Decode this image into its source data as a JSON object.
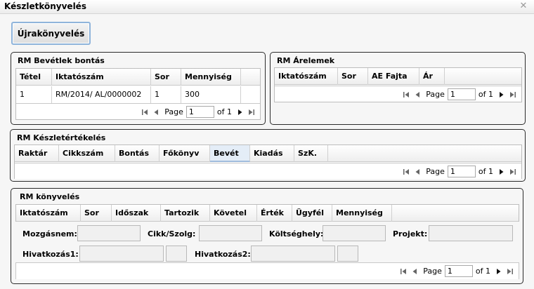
{
  "window": {
    "title": "Készletkönyvelés"
  },
  "toolbar": {
    "rebook_label": "Újrakönyvelés"
  },
  "pager_text": {
    "page": "Page",
    "of": "of 1",
    "page_value": "1"
  },
  "bevetel": {
    "title": "RM Bevétlek bontás",
    "columns": [
      "Tétel",
      "Iktatószám",
      "Sor",
      "Mennyiség"
    ],
    "rows": [
      [
        "1",
        "RM/2014/  AL/0000002",
        "1",
        "300"
      ]
    ]
  },
  "arelemek": {
    "title": "RM Árelemek",
    "columns": [
      "Iktatószám",
      "Sor",
      "AE Fajta",
      "Ár"
    ]
  },
  "keszletertekeles": {
    "title": "RM Készletértékelés",
    "columns": [
      "Raktár",
      "Cikkszám",
      "Bontás",
      "Főkönyv",
      "Bevét",
      "Kiadás",
      "SzK."
    ]
  },
  "konyveles": {
    "title": "RM könyvelés",
    "columns": [
      "Iktatószám",
      "Sor",
      "Időszak",
      "Tartozik",
      "Követel",
      "Érték",
      "Ügyfél",
      "Mennyiség"
    ],
    "fields": {
      "mozgasnem": "Mozgásnem:",
      "cikk": "Cikk/Szolg:",
      "koltseghely": "Költséghely:",
      "projekt": "Projekt:",
      "hivatkozas1": "Hivatkozás1:",
      "hivatkozas2": "Hivatkozás2:"
    }
  },
  "icons": [
    "close-icon",
    "first-page-icon",
    "prev-page-icon",
    "next-page-icon",
    "last-page-icon"
  ]
}
